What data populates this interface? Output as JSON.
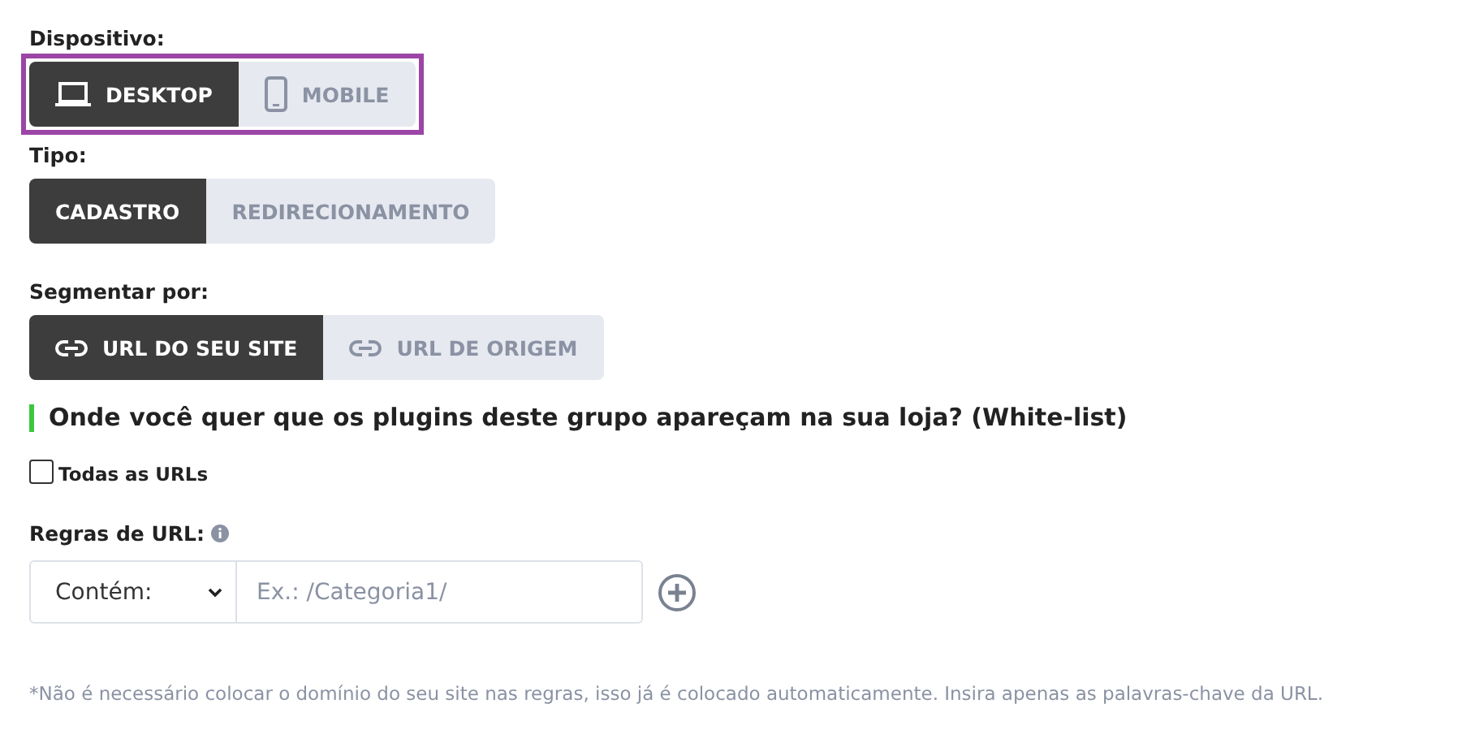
{
  "groups": [
    {
      "label": "Dispositivo:",
      "highlighted": true,
      "options": [
        {
          "label": "DESKTOP",
          "selected": true
        },
        {
          "label": "MOBILE",
          "selected": false
        }
      ]
    },
    {
      "label": "Tipo:",
      "highlighted": false,
      "options": [
        {
          "label": "CADASTRO",
          "selected": true
        },
        {
          "label": "REDIRECIONAMENTO",
          "selected": false
        }
      ]
    },
    {
      "label": "Segmentar por:",
      "highlighted": false,
      "options": [
        {
          "label": "URL DO SEU SITE",
          "selected": true
        },
        {
          "label": "URL DE ORIGEM",
          "selected": false
        }
      ]
    }
  ],
  "section_heading": "Onde você quer que os plugins deste grupo apareçam na sua loja? (White-list)",
  "all_urls": {
    "label": "Todas as URLs",
    "checked": false
  },
  "rules": {
    "label": "Regras de URL:",
    "match": "Contém:",
    "placeholder": "Ex.: /Categoria1/"
  },
  "footnote": "*Não é necessário colocar o domínio do seu site nas regras, isso já é colocado automaticamente. Insira apenas as palavras-chave da URL."
}
